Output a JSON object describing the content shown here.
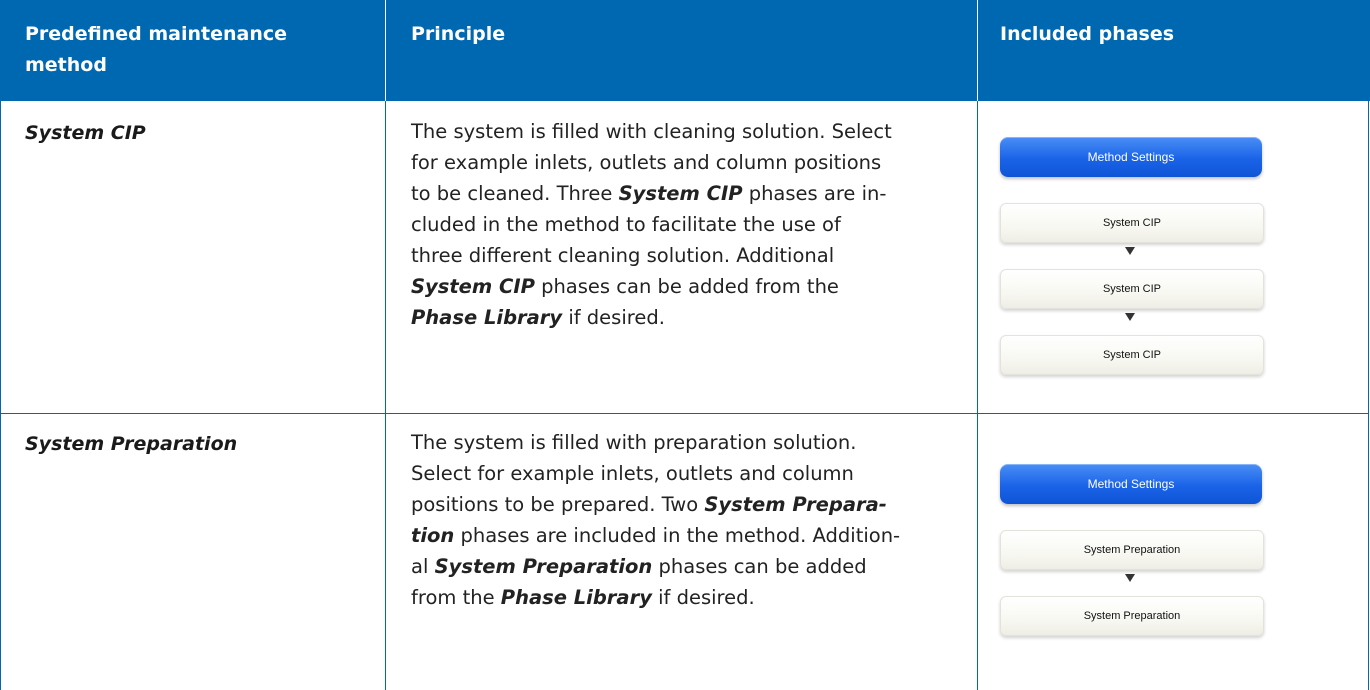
{
  "table": {
    "headers": [
      "Predefined maintenance method",
      "Principle",
      "Included phases"
    ],
    "rows": [
      {
        "method": "System CIP",
        "principle": [
          {
            "t": "The system is filled with cleaning solution. Select"
          },
          {
            "t": "for example inlets, outlets and column positions"
          },
          {
            "t": "to be cleaned. Three ",
            "b": "System CIP",
            "t2": " phases are in-"
          },
          {
            "t": "cluded in the method to facilitate the use of"
          },
          {
            "t": "three different cleaning solution. Additional"
          },
          {
            "b": "System CIP",
            "t2": " phases can be added from the"
          },
          {
            "b": "Phase Library",
            "t2": " if desired."
          }
        ],
        "diagram": {
          "settings_label": "Method Settings",
          "phases": [
            "System CIP",
            "System CIP",
            "System CIP"
          ]
        }
      },
      {
        "method": "System Preparation",
        "principle": [
          {
            "t": "The system is filled with preparation solution."
          },
          {
            "t": "Select for example inlets, outlets and column"
          },
          {
            "t": "positions to be prepared. Two ",
            "b": "System Prepara-"
          },
          {
            "b": "tion",
            "t2": " phases are included in the method. Addition-"
          },
          {
            "t": "al ",
            "b": "System Preparation",
            "t2": " phases can be added"
          },
          {
            "t": "from the ",
            "b": "Phase Library",
            "t2": " if desired."
          }
        ],
        "diagram": {
          "settings_label": "Method Settings",
          "phases": [
            "System Preparation",
            "System Preparation"
          ]
        }
      }
    ]
  },
  "colors": {
    "header_bg": "#0067b1",
    "settings_button": "#1a63e8"
  }
}
